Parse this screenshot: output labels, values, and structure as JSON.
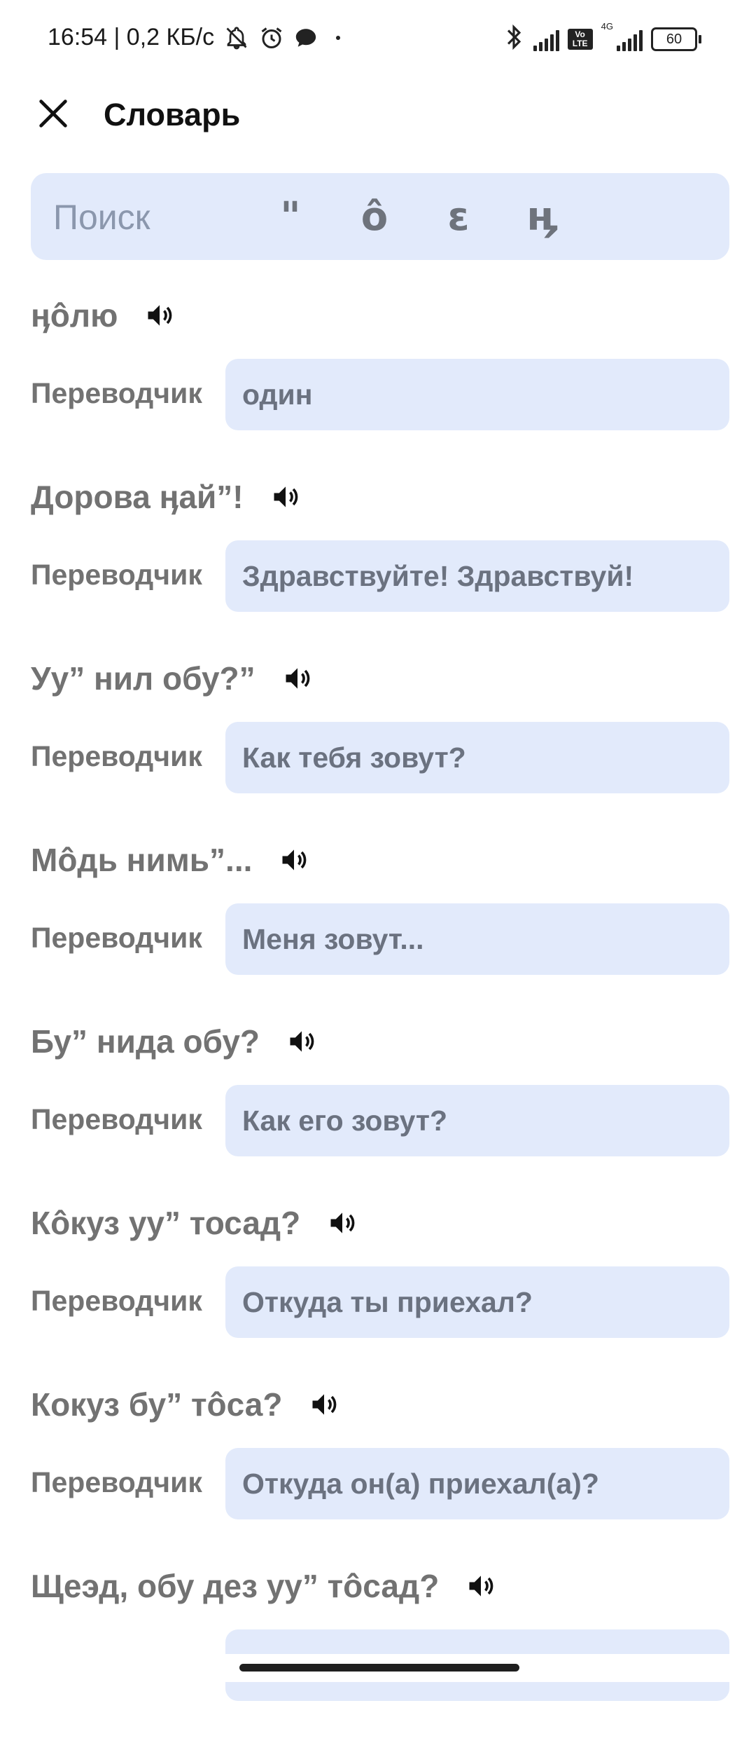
{
  "status_bar": {
    "time_and_speed": "16:54 | 0,2 КБ/с",
    "network_type": "4G",
    "volte": "Vo LTE",
    "battery": "60"
  },
  "app_bar": {
    "title": "Словарь",
    "close_icon": "close-icon"
  },
  "search": {
    "placeholder": "Поиск",
    "special_keys": [
      "\"",
      "ô",
      "ɛ",
      "ӊ"
    ]
  },
  "translator_label": "Переводчик",
  "entries": [
    {
      "phrase": "ӊôлю",
      "translation": "один"
    },
    {
      "phrase": "Дорова ӊай”!",
      "translation": "Здравствуйте! Здравствуй!"
    },
    {
      "phrase": "Уу” нил обу?”",
      "translation": "Как тебя зовут?"
    },
    {
      "phrase": "Мôдь нимь”...",
      "translation": "Меня зовут..."
    },
    {
      "phrase": "Бу” нида обу?",
      "translation": "Как его зовут?"
    },
    {
      "phrase": "Кôкуз уу” тосад?",
      "translation": "Откуда ты приехал?"
    },
    {
      "phrase": "Кокуз бу” тôса?",
      "translation": "Откуда он(а) приехал(а)?"
    },
    {
      "phrase": "Щеэд, обу дез уу” тôсад?",
      "translation": ""
    }
  ],
  "colors": {
    "field_background": "#e2eafb",
    "label_gray": "#727272",
    "translation_text": "#6b7280"
  }
}
